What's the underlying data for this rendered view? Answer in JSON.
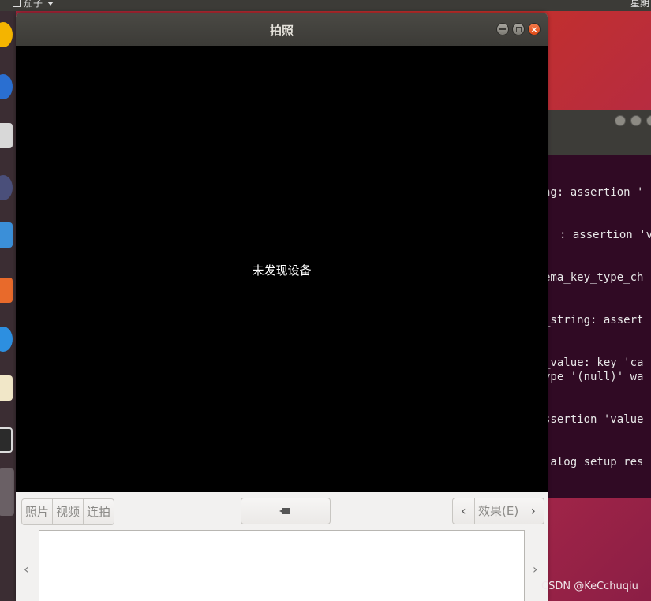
{
  "top_panel": {
    "app_name": "茄子",
    "clock": "星期"
  },
  "window": {
    "title": "拍照",
    "viewport_message": "未发现设备",
    "modes": [
      "照片",
      "视频",
      "连拍"
    ],
    "effects_label": "效果(E)"
  },
  "terminal": {
    "lines": [
      "ng: assertion '",
      ": assertion 'va",
      "ema_key_type_ch",
      "_string: assert",
      "_value: key 'ca",
      "ype '(null)' wa",
      "ssertion 'value",
      "ialog_setup_res"
    ]
  },
  "watermark": "CSDN @KeCchuqiu",
  "colors": {
    "close_button": "#df4a16",
    "terminal_bg": "#300a24",
    "titlebar": "#3c3b37"
  }
}
